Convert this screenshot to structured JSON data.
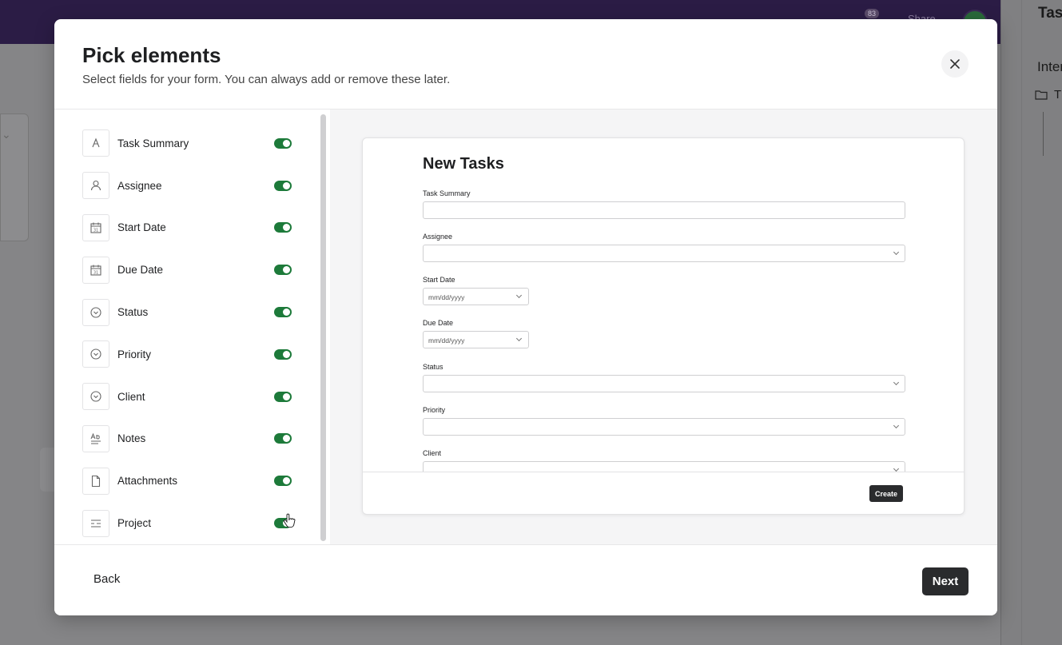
{
  "background": {
    "badge_count": "83",
    "share_label": "Share",
    "right_title": "Task",
    "right_subtitle": "Inter",
    "right_row_label": "T"
  },
  "modal": {
    "title": "Pick elements",
    "subtitle": "Select fields for your form. You can always add or remove these later.",
    "fields": [
      {
        "label": "Task Summary",
        "icon": "text-icon",
        "enabled": true
      },
      {
        "label": "Assignee",
        "icon": "person-icon",
        "enabled": true
      },
      {
        "label": "Start Date",
        "icon": "calendar-icon",
        "enabled": true
      },
      {
        "label": "Due Date",
        "icon": "calendar-icon",
        "enabled": true
      },
      {
        "label": "Status",
        "icon": "dropdown-circle-icon",
        "enabled": true
      },
      {
        "label": "Priority",
        "icon": "dropdown-circle-icon",
        "enabled": true
      },
      {
        "label": "Client",
        "icon": "dropdown-circle-icon",
        "enabled": true
      },
      {
        "label": "Notes",
        "icon": "rich-text-icon",
        "enabled": true
      },
      {
        "label": "Attachments",
        "icon": "file-icon",
        "enabled": true
      },
      {
        "label": "Project",
        "icon": "project-list-icon",
        "enabled": true
      }
    ],
    "preview": {
      "title": "New Tasks",
      "fields": {
        "task_summary": "Task Summary",
        "assignee": "Assignee",
        "start_date": "Start Date",
        "start_date_placeholder": "mm/dd/yyyy",
        "due_date": "Due Date",
        "due_date_placeholder": "mm/dd/yyyy",
        "status": "Status",
        "priority": "Priority",
        "client": "Client"
      },
      "create_label": "Create"
    },
    "back_label": "Back",
    "next_label": "Next"
  },
  "colors": {
    "toggle_on": "#1d7a3a",
    "topbar": "#2b1c45",
    "button_dark": "#2a2b2d"
  }
}
